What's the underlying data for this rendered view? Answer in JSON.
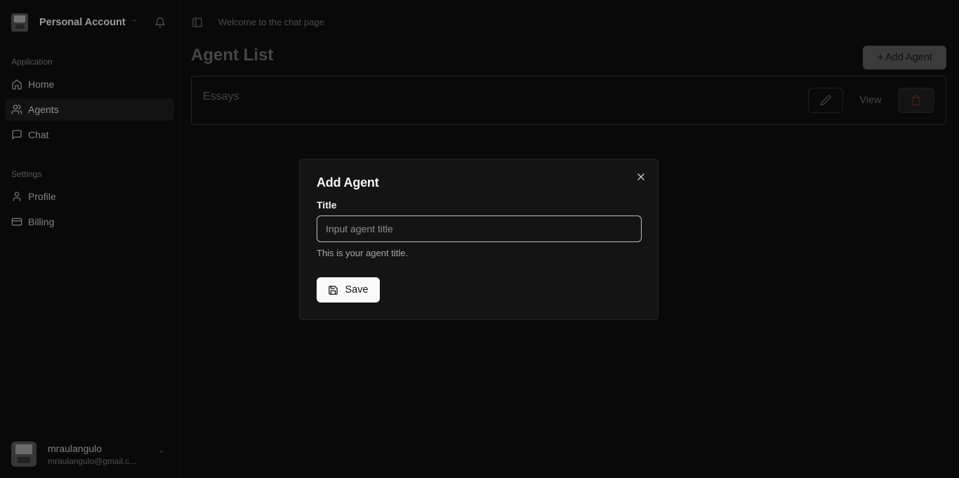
{
  "sidebar": {
    "account_name": "Personal Account",
    "groups": [
      {
        "label": "Application"
      },
      {
        "label": "Settings"
      }
    ],
    "items": [
      {
        "label": "Home",
        "icon": "home-icon"
      },
      {
        "label": "Agents",
        "icon": "users-icon",
        "active": true
      },
      {
        "label": "Chat",
        "icon": "message-square-icon"
      },
      {
        "label": "Profile",
        "icon": "user-icon"
      },
      {
        "label": "Billing",
        "icon": "credit-card-icon"
      }
    ],
    "user": {
      "name": "mraulangulo",
      "email": "mraulangulo@gmail.c..."
    }
  },
  "header": {
    "welcome_text": "Welcome to the chat page"
  },
  "main": {
    "title": "Agent List",
    "add_button_label": "Add Agent",
    "agents": [
      {
        "title": "Essays",
        "view_label": "View"
      }
    ]
  },
  "modal": {
    "title": "Add Agent",
    "field_label": "Title",
    "input_placeholder": "Input agent title",
    "input_value": "",
    "description": "This is your agent title.",
    "save_label": "Save"
  },
  "colors": {
    "background": "#0a0a0a",
    "modal_bg": "#141414",
    "primary_button": "#fafafa",
    "destructive": "#5a1d1d"
  }
}
